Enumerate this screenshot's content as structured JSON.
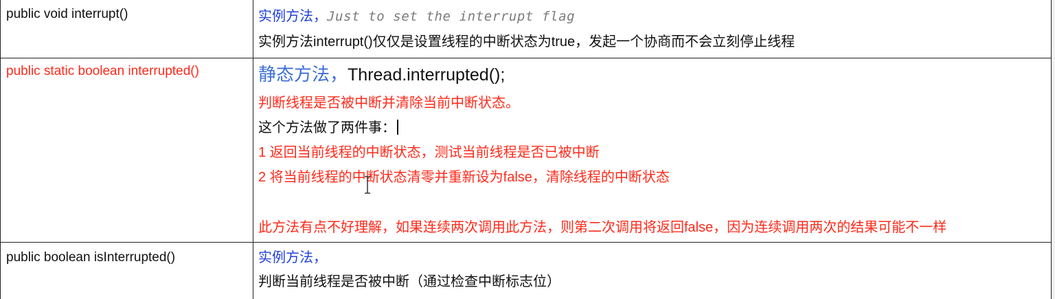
{
  "rows": [
    {
      "signature": "public void interrupt()",
      "lines": {
        "l1_kind": "实例方法，",
        "l1_note": "Just to set the interrupt flag",
        "l2": "实例方法interrupt()仅仅是设置线程的中断状态为true，发起一个协商而不会立刻停止线程"
      }
    },
    {
      "signature": "public static boolean interrupted()",
      "lines": {
        "l1_kind": "静态方法，",
        "l1_code": "Thread.interrupted();",
        "l2": "判断线程是否被中断并清除当前中断状态。",
        "l3": "这个方法做了两件事：",
        "l4": "1 返回当前线程的中断状态，测试当前线程是否已被中断",
        "l5": "2 将当前线程的中断状态清零并重新设为false，清除线程的中断状态",
        "l6": "此方法有点不好理解，如果连续两次调用此方法，则第二次调用将返回false，因为连续调用两次的结果可能不一样"
      }
    },
    {
      "signature": "public boolean isInterrupted()",
      "lines": {
        "l1_kind": "实例方法，",
        "l2": "判断当前线程是否被中断（通过检查中断标志位）"
      }
    }
  ],
  "colors": {
    "blue": "#1f3fd9",
    "red": "#ff2a1a",
    "gray": "#7b7b7b",
    "border": "#222222"
  },
  "icons": {
    "cursor": "text-caret",
    "pointer": "i-beam-cursor-icon"
  }
}
